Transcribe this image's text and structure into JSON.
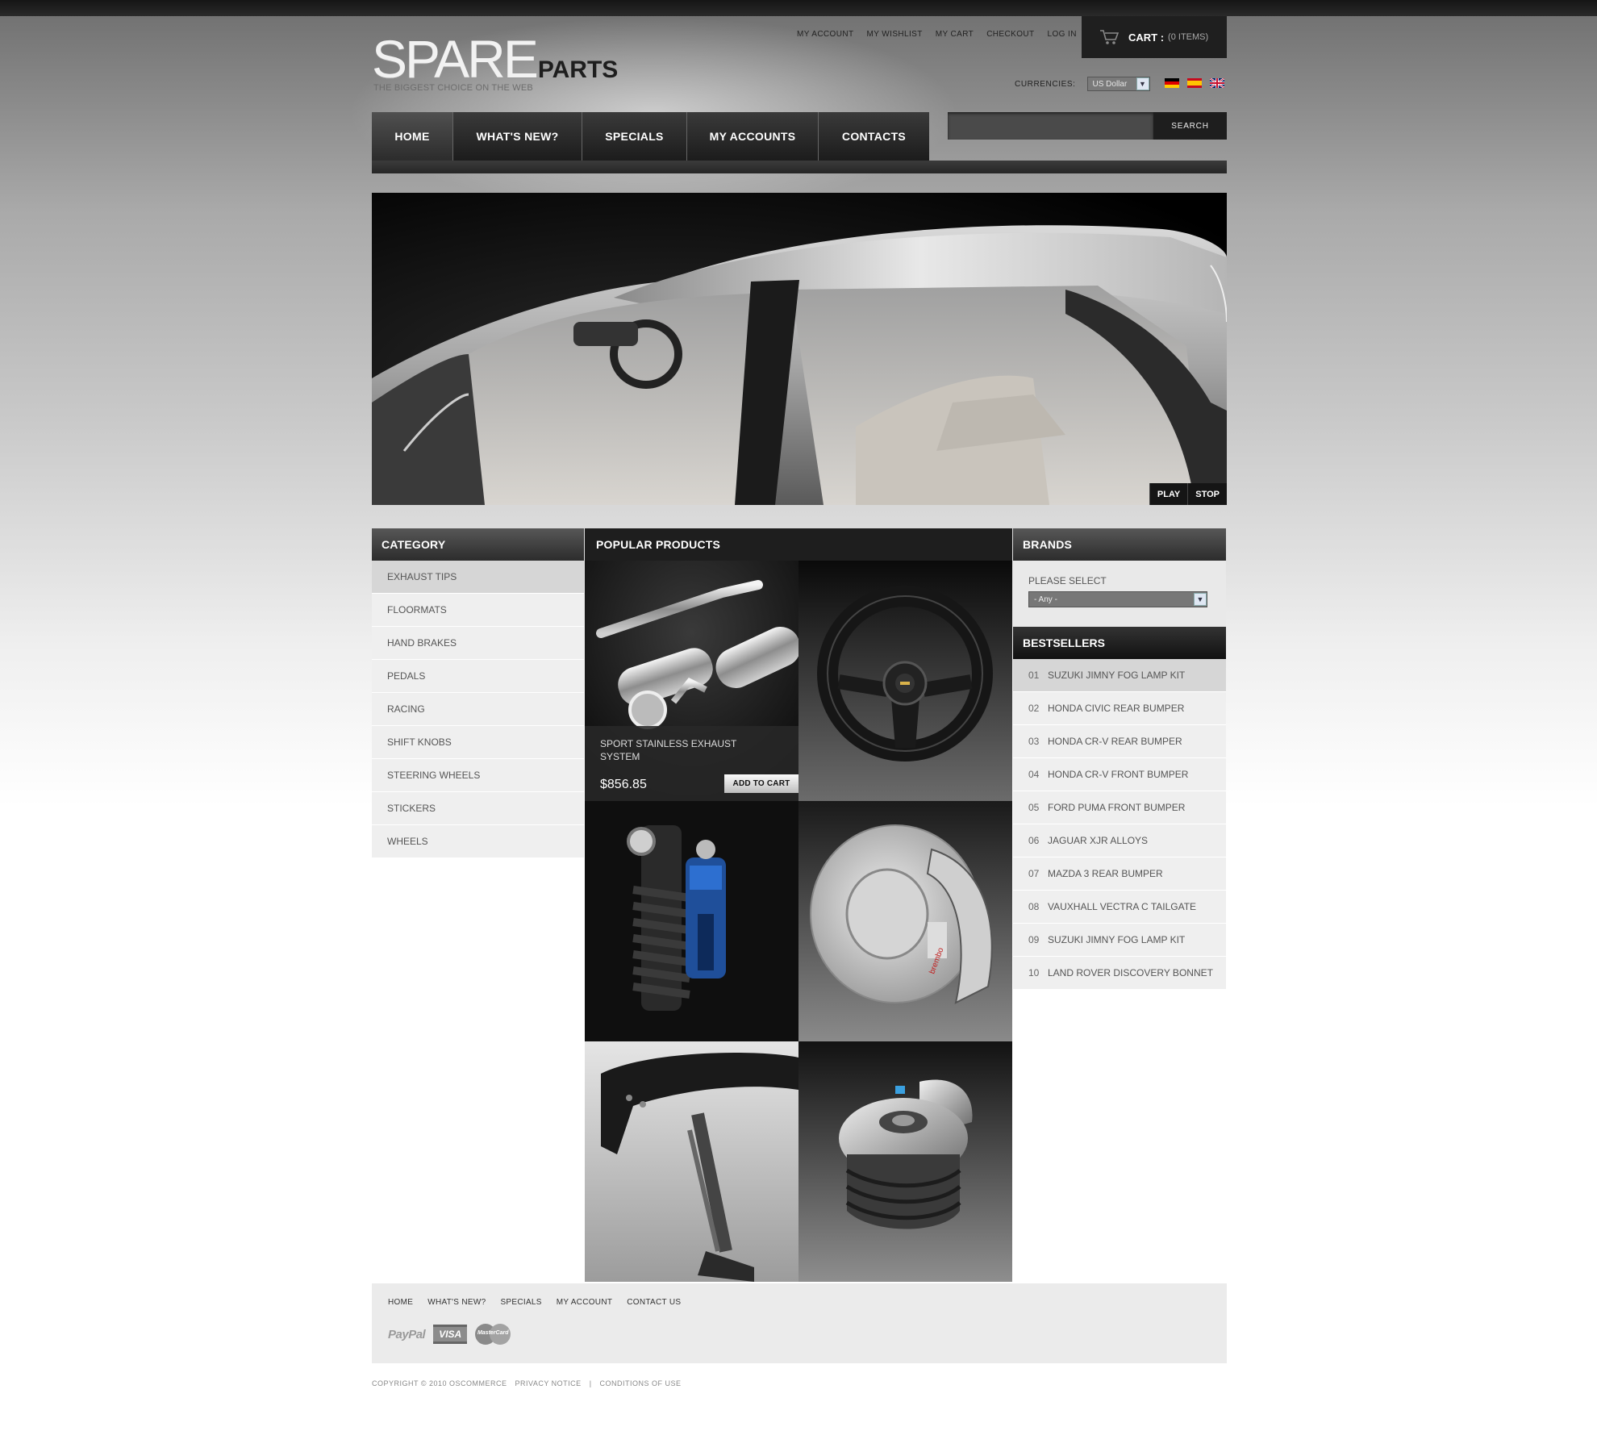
{
  "logo": {
    "main": "SPARE",
    "sub": "PARTS",
    "tagline": "THE BIGGEST CHOICE ON THE WEB"
  },
  "top_links": [
    "MY ACCOUNT",
    "MY WISHLIST",
    "MY CART",
    "CHECKOUT",
    "LOG IN"
  ],
  "cart": {
    "label": "CART :",
    "count": "(0 ITEMS)",
    "icon": "cart-icon"
  },
  "currency": {
    "label": "CURRENCIES:",
    "selected": "US Dollar"
  },
  "languages": [
    "german-flag",
    "spanish-flag",
    "english-flag"
  ],
  "nav": [
    "HOME",
    "WHAT'S NEW?",
    "SPECIALS",
    "MY ACCOUNTS",
    "CONTACTS"
  ],
  "search": {
    "button": "SEARCH",
    "value": ""
  },
  "hero": {
    "play": "PLAY",
    "stop": "STOP"
  },
  "category": {
    "title": "CATEGORY",
    "items": [
      "EXHAUST TIPS",
      "FLOORMATS",
      "HAND BRAKES",
      "PEDALS",
      "RACING",
      "SHIFT KNOBS",
      "STEERING WHEELS",
      "STICKERS",
      "WHEELS"
    ]
  },
  "popular": {
    "title": "POPULAR PRODUCTS",
    "featured": {
      "name": "SPORT STAINLESS EXHAUST SYSTEM",
      "price": "$856.85",
      "cart_button": "ADD TO CART"
    }
  },
  "brands": {
    "title": "BRANDS",
    "label": "PLEASE SELECT",
    "selected": "- Any -"
  },
  "bestsellers": {
    "title": "BESTSELLERS",
    "items": [
      {
        "num": "01",
        "name": "SUZUKI JIMNY FOG LAMP KIT"
      },
      {
        "num": "02",
        "name": "HONDA CIVIC REAR BUMPER"
      },
      {
        "num": "03",
        "name": "HONDA CR-V REAR BUMPER"
      },
      {
        "num": "04",
        "name": "HONDA CR-V FRONT BUMPER"
      },
      {
        "num": "05",
        "name": "FORD PUMA FRONT BUMPER"
      },
      {
        "num": "06",
        "name": "JAGUAR XJR ALLOYS"
      },
      {
        "num": "07",
        "name": "MAZDA 3 REAR BUMPER"
      },
      {
        "num": "08",
        "name": "VAUXHALL VECTRA C TAILGATE"
      },
      {
        "num": "09",
        "name": "SUZUKI JIMNY FOG LAMP KIT"
      },
      {
        "num": "10",
        "name": "LAND ROVER DISCOVERY BONNET"
      }
    ]
  },
  "footer": {
    "links": [
      "HOME",
      "WHAT'S NEW?",
      "SPECIALS",
      "MY ACCOUNT",
      "CONTACT US"
    ],
    "payments": {
      "paypal": "PayPal",
      "visa": "VISA",
      "mastercard": "MasterCard"
    },
    "copyright": "COPYRIGHT © 2010 OSCOMMERCE",
    "privacy": "PRIVACY NOTICE",
    "separator": "|",
    "conditions": "CONDITIONS OF USE"
  }
}
